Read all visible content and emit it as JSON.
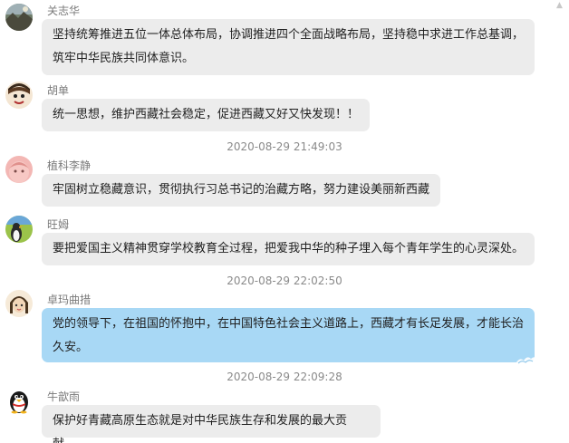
{
  "messages": [
    {
      "sender": "关志华",
      "avatar": "landscape-photo-avatar",
      "lines": [
        "坚持统筹推进五位一体总体布局，协调推进四个全面战略布局，坚持稳中求进工作总基调，",
        "筑牢中华民族共同体意识。"
      ]
    },
    {
      "sender": "胡单",
      "avatar": "cartoon-face-avatar",
      "lines": [
        "统一思想，维护西藏社会稳定，促进西藏又好又快发现！！"
      ]
    },
    {
      "sender": "植科李静",
      "avatar": "pink-face-avatar",
      "lines": [
        "牢固树立稳藏意识，贯彻执行习总书记的治藏方略，努力建设美丽新西藏"
      ]
    },
    {
      "sender": "旺姆",
      "avatar": "penguin-avatar",
      "lines": [
        "要把爱国主义精神贯穿学校教育全过程，把爱我中华的种子埋入每个青年学生的心灵深处。"
      ]
    },
    {
      "sender": "卓玛曲措",
      "avatar": "girl-avatar",
      "lines": [
        "党的领导下，在祖国的怀抱中，在中国特色社会主义道路上，西藏才有长足发展，才能长治",
        "久安。"
      ]
    },
    {
      "sender": "牛歆雨",
      "avatar": "qq-penguin-avatar",
      "lines": [
        "保护好青藏高原生态就是对中华民族生存和发展的最大贡献。"
      ]
    }
  ],
  "timestamps": [
    "2020-08-29 21:49:03",
    "2020-08-29 22:02:50",
    "2020-08-29 22:09:28"
  ],
  "colors": {
    "bubble": "#ececec",
    "special_bubble": "#a8d8f5",
    "sender_text": "#7a7a7a",
    "timestamp_text": "#8a8a8a"
  }
}
